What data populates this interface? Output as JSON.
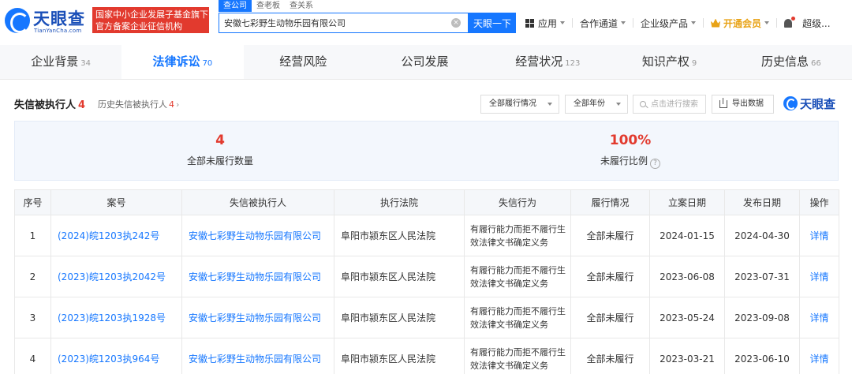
{
  "header": {
    "logo_name": "天眼查",
    "logo_domain": "TianYanCha.com",
    "gov_badge_line1": "国家中小企业发展子基金旗下",
    "gov_badge_line2": "官方备案企业征信机构",
    "search_tabs": [
      "查公司",
      "查老板",
      "查关系"
    ],
    "search_value": "安徽七彩野生动物乐园有限公司",
    "search_button": "天眼一下",
    "nav": {
      "apps": "应用",
      "channel": "合作通道",
      "enterprise": "企业级产品",
      "vip": "开通会员",
      "user": "超级..."
    }
  },
  "main_tabs": [
    {
      "label": "企业背景",
      "count": "34"
    },
    {
      "label": "法律诉讼",
      "count": "70"
    },
    {
      "label": "经营风险",
      "count": ""
    },
    {
      "label": "公司发展",
      "count": ""
    },
    {
      "label": "经营状况",
      "count": "123"
    },
    {
      "label": "知识产权",
      "count": "9"
    },
    {
      "label": "历史信息",
      "count": "66"
    }
  ],
  "section": {
    "title": "失信被执行人",
    "count": "4",
    "history_label": "历史失信被执行人",
    "history_count": "4",
    "filter_status": "全部履行情况",
    "filter_year": "全部年份",
    "search_placeholder": "点击进行搜索",
    "export_label": "导出数据",
    "brand_name": "天眼查"
  },
  "stats": {
    "unfulfilled_count": "4",
    "unfulfilled_count_label": "全部未履行数量",
    "unfulfilled_ratio": "100%",
    "unfulfilled_ratio_label": "未履行比例"
  },
  "table": {
    "headers": [
      "序号",
      "案号",
      "失信被执行人",
      "执行法院",
      "失信行为",
      "履行情况",
      "立案日期",
      "发布日期",
      "操作"
    ],
    "rows": [
      {
        "no": "1",
        "case_no": "(2024)皖1203执242号",
        "party": "安徽七彩野生动物乐园有限公司",
        "court": "阜阳市颍东区人民法院",
        "behavior": "有履行能力而拒不履行生效法律文书确定义务",
        "status": "全部未履行",
        "filed": "2024-01-15",
        "published": "2024-04-30",
        "action": "详情"
      },
      {
        "no": "2",
        "case_no": "(2023)皖1203执2042号",
        "party": "安徽七彩野生动物乐园有限公司",
        "court": "阜阳市颍东区人民法院",
        "behavior": "有履行能力而拒不履行生效法律文书确定义务",
        "status": "全部未履行",
        "filed": "2023-06-08",
        "published": "2023-07-31",
        "action": "详情"
      },
      {
        "no": "3",
        "case_no": "(2023)皖1203执1928号",
        "party": "安徽七彩野生动物乐园有限公司",
        "court": "阜阳市颍东区人民法院",
        "behavior": "有履行能力而拒不履行生效法律文书确定义务",
        "status": "全部未履行",
        "filed": "2023-05-24",
        "published": "2023-09-08",
        "action": "详情"
      },
      {
        "no": "4",
        "case_no": "(2023)皖1203执964号",
        "party": "安徽七彩野生动物乐园有限公司",
        "court": "阜阳市颍东区人民法院",
        "behavior": "有履行能力而拒不履行生效法律文书确定义务",
        "status": "全部未履行",
        "filed": "2023-03-21",
        "published": "2023-06-10",
        "action": "详情"
      }
    ]
  },
  "colors": {
    "accent": "#1677ff",
    "brand": "#1a4fb8",
    "alert": "#e23a2e",
    "vip": "#e8a317"
  }
}
